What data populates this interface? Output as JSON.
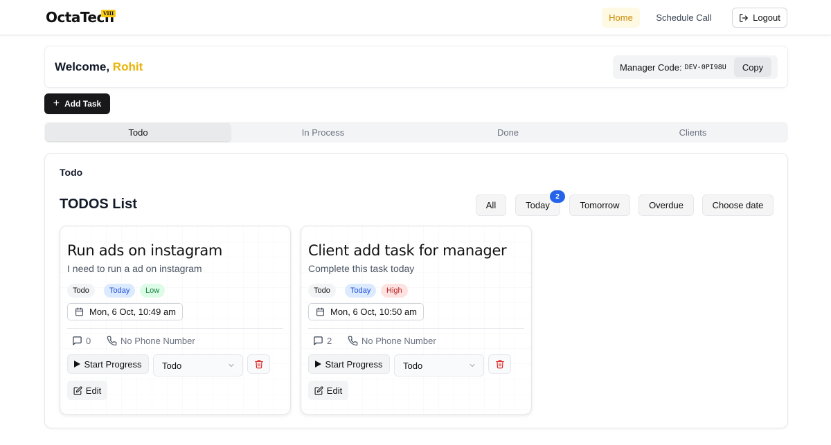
{
  "header": {
    "brand": "OctaTech",
    "brand_badge": "VIII",
    "nav": {
      "home": "Home",
      "schedule_call": "Schedule Call",
      "logout": "Logout"
    }
  },
  "welcome": {
    "greeting": "Welcome,",
    "name": "Rohit",
    "manager_code_label": "Manager Code:",
    "manager_code": "DEV-0PI98U",
    "copy_label": "Copy"
  },
  "add_task_label": "Add Task",
  "tabs": [
    "Todo",
    "In Process",
    "Done",
    "Clients"
  ],
  "active_tab": "Todo",
  "panel": {
    "title": "Todo",
    "list_title": "TODOS List",
    "filters": [
      "All",
      "Today",
      "Tomorrow",
      "Overdue",
      "Choose date"
    ],
    "today_badge": "2"
  },
  "tasks": [
    {
      "title": "Run ads on instagram",
      "description": "I need to run a ad on instagram",
      "status": "Todo",
      "day": "Today",
      "priority": "Low",
      "datetime": "Mon, 6 Oct, 10:49 am",
      "comments": "0",
      "phone": "No Phone Number",
      "start_label": "Start Progress",
      "select_value": "Todo",
      "edit_label": "Edit"
    },
    {
      "title": "Client add task for manager",
      "description": "Complete this task today",
      "status": "Todo",
      "day": "Today",
      "priority": "High",
      "datetime": "Mon, 6 Oct, 10:50 am",
      "comments": "2",
      "phone": "No Phone Number",
      "start_label": "Start Progress",
      "select_value": "Todo",
      "edit_label": "Edit"
    }
  ],
  "colors": {
    "accent_yellow": "#eab308",
    "badge_blue": "#2563eb",
    "delete_red": "#dc2626"
  }
}
